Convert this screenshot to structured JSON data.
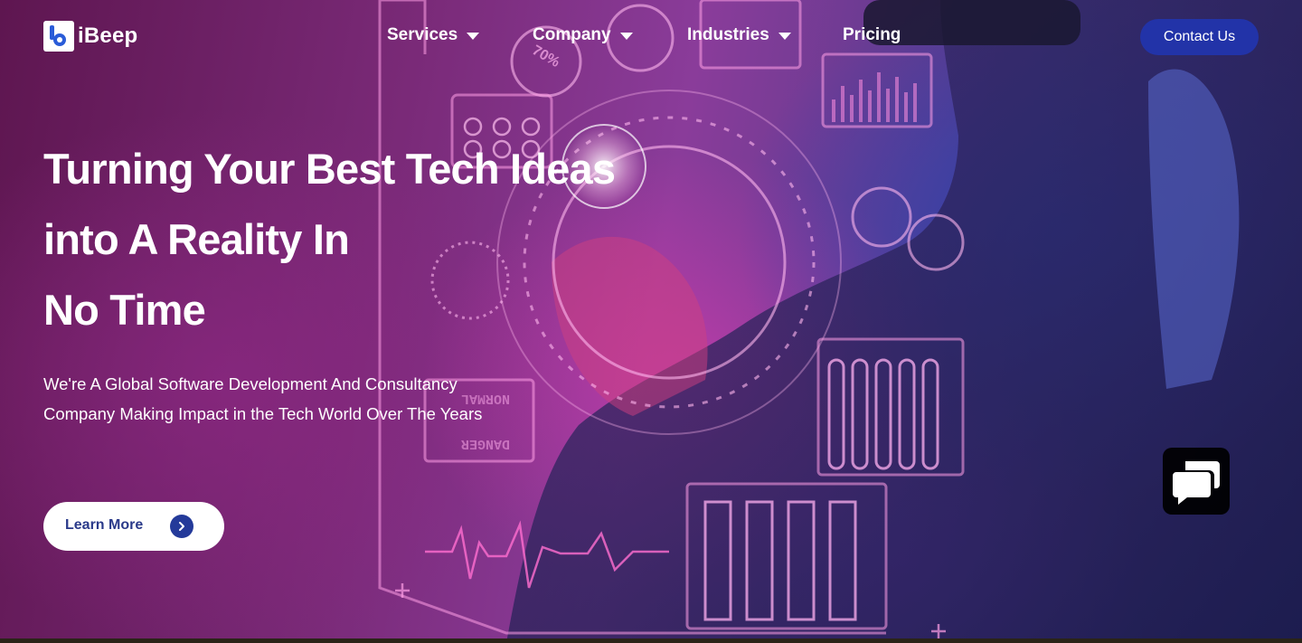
{
  "brand": {
    "name": "iBeep",
    "accent_color": "#2233a8"
  },
  "nav": {
    "items": [
      {
        "label": "Services",
        "has_dropdown": true
      },
      {
        "label": "Company",
        "has_dropdown": true
      },
      {
        "label": "Industries",
        "has_dropdown": true
      },
      {
        "label": "Pricing",
        "has_dropdown": false
      }
    ],
    "contact_label": "Contact Us"
  },
  "hero": {
    "headline_lines": [
      "Turning Your Best Tech Ideas",
      "into A Reality In",
      "No Time"
    ],
    "subtext": "We're A Global Software Development And Consultancy Company Making Impact in the Tech World Over The Years",
    "cta_label": "Learn More",
    "cta_icon": "chevron-right-icon"
  },
  "hud_labels": {
    "gauge_percent": "70%",
    "normal": "NORMAL",
    "danger": "DANGER"
  },
  "chat_widget": {
    "icon": "chat-bubbles-icon"
  }
}
